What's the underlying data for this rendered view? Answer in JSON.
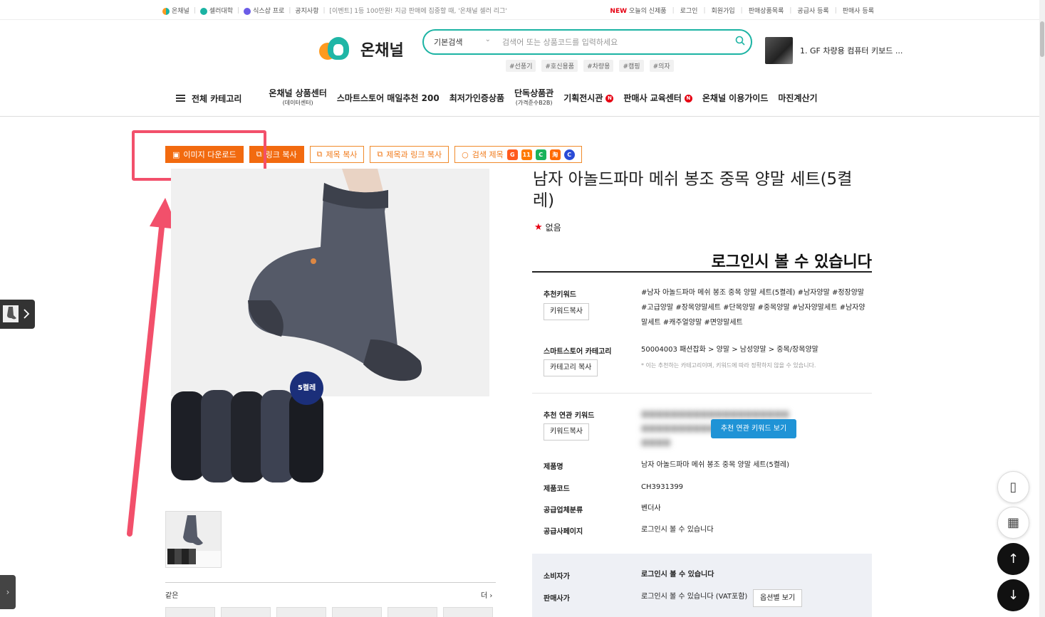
{
  "topbar": {
    "brand1": "온채널",
    "brand2": "셀러대학",
    "brand3": "식스샵 프로",
    "notice": "공지사항",
    "event": "[이벤트] 1등 100만원! 지금 판매에 집중할 때, '온채널 셀러 리그'",
    "new_badge": "NEW",
    "new_products": "오늘의 신제품",
    "login": "로그인",
    "signup": "회원가입",
    "seller_list": "판매상품목록",
    "supplier_register": "공급사 등록",
    "seller_register": "판매사 등록"
  },
  "header": {
    "logo_text": "온채널",
    "search_mode": "기본검색",
    "search_placeholder": "검색어 또는 상품코드를 입력하세요",
    "tags": [
      "#선풍기",
      "#호신용품",
      "#차량용",
      "#캠핑",
      "#의자"
    ],
    "ranking_text": "1. GF 차량용 컴퓨터 키보드 ..."
  },
  "nav": {
    "all_categories": "전체 카테고리",
    "items": [
      {
        "label": "온채널 상품센터",
        "sub": "(데이터센터)",
        "badge": ""
      },
      {
        "label": "스마트스토어 매일추천 200",
        "sub": "",
        "badge": ""
      },
      {
        "label": "최저가인증상품",
        "sub": "",
        "badge": ""
      },
      {
        "label": "단독상품관",
        "sub": "(가격준수B2B)",
        "badge": ""
      },
      {
        "label": "기획전시관",
        "sub": "",
        "badge": "N"
      },
      {
        "label": "판매사 교육센터",
        "sub": "",
        "badge": "N"
      },
      {
        "label": "온채널 이용가이드",
        "sub": "",
        "badge": ""
      },
      {
        "label": "마진계산기",
        "sub": "",
        "badge": ""
      }
    ]
  },
  "actions": {
    "image_download": "이미지 다운로드",
    "link_copy": "링크 복사",
    "title_copy": "제목 복사",
    "title_link_copy": "제목과 링크 복사",
    "search_title": "검색 제목"
  },
  "product": {
    "badge": "5켤레",
    "title": "남자 아놀드파마 메쉬 봉조 중목 양말 세트(5켤레)",
    "rating_text": "없음",
    "price_login": "로그인시 볼 수 있습니다",
    "same_label": "같은",
    "more": "더"
  },
  "info": {
    "rec_keyword_label": "추천키워드",
    "rec_keyword_btn": "키워드복사",
    "rec_keyword_value": "#남자 아놀드파마 메쉬 봉조 중목 양말 세트(5켤레) #남자양말 #정장양말 #고급양말 #장목양말세트 #단목양말 #중목양말 #남자양말세트 #남자양말세트 #캐주얼양말 #면양말세트",
    "ss_category_label": "스마트스토어 카테고리",
    "ss_category_btn": "카테고리 복사",
    "ss_category_value": "50004003 패션잡화 > 양말 > 남성양말 > 중목/장목양말",
    "ss_category_note": "* 이는 추천하는 카테고리이며, 키워드에 따라 정확하지 않을 수 있습니다.",
    "related_label": "추천 연관 키워드",
    "related_btn": "키워드복사",
    "related_show_btn": "추천 연관 키워드 보기",
    "name_label": "제품명",
    "name_value": "남자 아놀드파마 메쉬 봉조 중목 양말 세트(5켤레)",
    "code_label": "제품코드",
    "code_value": "CH3931399",
    "supplier_type_label": "공급업체분류",
    "supplier_type_value": "벤더사",
    "supplier_page_label": "공급사페이지",
    "supplier_page_value": "로그인시 볼 수 있습니다",
    "consumer_label": "소비자가",
    "consumer_value": "로그인시 볼 수 있습니다",
    "seller_label": "판매사가",
    "seller_value": "로그인시 볼 수 있습니다 (VAT포함)",
    "option_btn": "옵션별 보기"
  },
  "colors": {
    "accent_teal": "#1bb3a3",
    "accent_orange": "#f26a0f",
    "highlight_pink": "#f2506b",
    "button_blue": "#1f93d6"
  }
}
